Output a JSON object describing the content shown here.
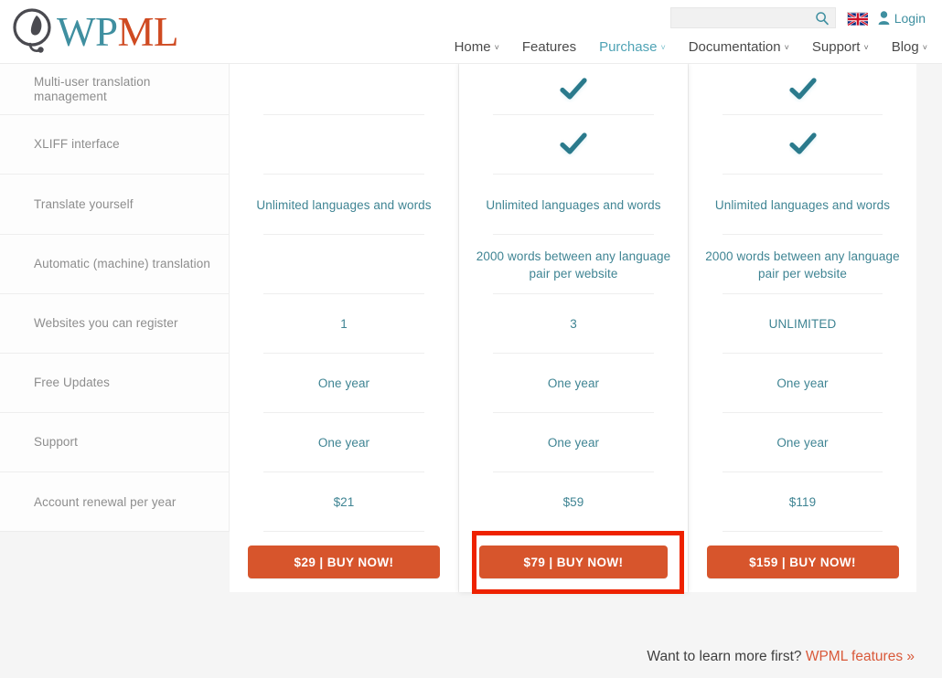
{
  "brand": {
    "logo_wp": "WP",
    "logo_ml": "ML",
    "logo_icon": "wpml-logo-icon",
    "logo_wp_color": "#3f8fa0",
    "logo_ml_color": "#cf4a21"
  },
  "header": {
    "search": {
      "value": "",
      "placeholder": "",
      "icon": "search-icon"
    },
    "language_flag": "uk-flag-icon",
    "login_label": "Login",
    "login_icon": "user-icon",
    "accent_color": "#3f8fa0"
  },
  "nav": {
    "items": [
      {
        "label": "Home",
        "has_caret": true,
        "active": false
      },
      {
        "label": "Features",
        "has_caret": false,
        "active": false
      },
      {
        "label": "Purchase",
        "has_caret": true,
        "active": true
      },
      {
        "label": "Documentation",
        "has_caret": true,
        "active": false
      },
      {
        "label": "Support",
        "has_caret": true,
        "active": false
      },
      {
        "label": "Blog",
        "has_caret": true,
        "active": false
      }
    ],
    "caret_glyph": "˅"
  },
  "pricing_table": {
    "features": [
      "Multi-user translation management",
      "XLIFF interface",
      "Translate yourself",
      "Automatic (machine) translation",
      "Websites you can register",
      "Free Updates",
      "Support",
      "Account renewal per year"
    ],
    "columns": [
      {
        "id": "col-1",
        "values": [
          "",
          "",
          "Unlimited languages and words",
          "",
          "1",
          "One year",
          "One year",
          "$21"
        ],
        "checks": [
          false,
          false,
          false,
          false,
          false,
          false,
          false,
          false
        ],
        "buy_label": "$29 | BUY NOW!",
        "highlighted": false
      },
      {
        "id": "col-2",
        "values": [
          "",
          "",
          "Unlimited languages and words",
          "2000 words between any language pair per website",
          "3",
          "One year",
          "One year",
          "$59"
        ],
        "checks": [
          true,
          true,
          false,
          false,
          false,
          false,
          false,
          false
        ],
        "buy_label": "$79 | BUY NOW!",
        "highlighted": true
      },
      {
        "id": "col-3",
        "values": [
          "",
          "",
          "Unlimited languages and words",
          "2000 words between any language pair per website",
          "UNLIMITED",
          "One year",
          "One year",
          "$119"
        ],
        "checks": [
          true,
          true,
          false,
          false,
          false,
          false,
          false,
          false
        ],
        "buy_label": "$159 | BUY NOW!",
        "highlighted": false
      }
    ],
    "value_color": "#3f8493",
    "feature_color": "#8d8d8d",
    "button_color": "#d7552c",
    "check_color": "#2a7a8c",
    "highlight_box_color": "#ee2200"
  },
  "footer": {
    "learn_more_text": "Want to learn more first?",
    "learn_more_link": "WPML features »",
    "link_color": "#d9593a"
  }
}
